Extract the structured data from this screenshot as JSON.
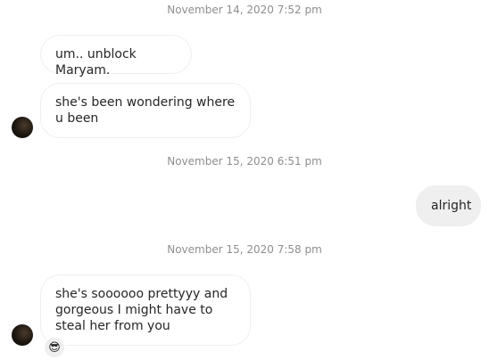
{
  "messages": [
    {
      "type": "timestamp",
      "text": "November 14, 2020 7:52 pm"
    },
    {
      "type": "received",
      "text": "um.. unblock Maryam."
    },
    {
      "type": "received",
      "text": "she's been wondering where u been"
    },
    {
      "type": "timestamp",
      "text": "November 15, 2020 6:51 pm"
    },
    {
      "type": "sent",
      "text": "alright"
    },
    {
      "type": "timestamp",
      "text": "November 15, 2020 7:58 pm"
    },
    {
      "type": "received",
      "text": "she's soooooo prettyyy and gorgeous I might have to steal her from you",
      "reaction": "😎"
    }
  ],
  "icons": {
    "avatar": "user-avatar",
    "reaction": "sunglasses-emoji-icon"
  }
}
